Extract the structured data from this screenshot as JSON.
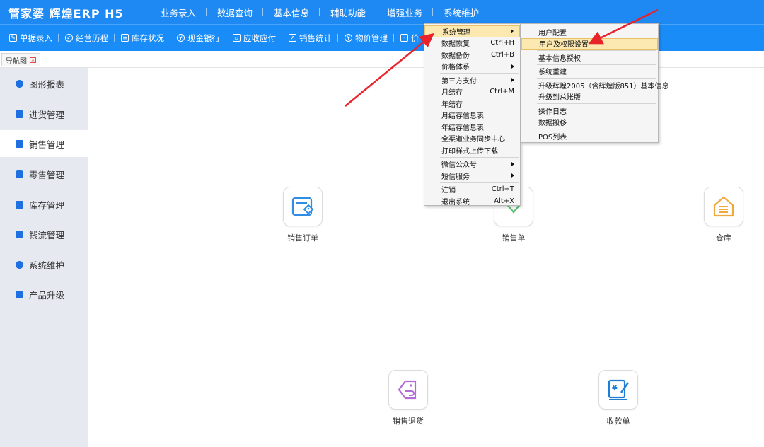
{
  "header": {
    "logo": "管家婆 辉煌ERP H5",
    "nav": [
      "业务录入",
      "数据查询",
      "基本信息",
      "辅助功能",
      "增强业务",
      "系统维护"
    ]
  },
  "toolbar": {
    "items": [
      {
        "label": "单据录入",
        "icon": "edit-icon"
      },
      {
        "label": "经营历程",
        "icon": "history-icon"
      },
      {
        "label": "库存状况",
        "icon": "calendar-icon"
      },
      {
        "label": "现金银行",
        "icon": "money-icon"
      },
      {
        "label": "应收应付",
        "icon": "receivable-icon"
      },
      {
        "label": "销售统计",
        "icon": "chart-icon"
      },
      {
        "label": "物价管理",
        "icon": "price-icon"
      },
      {
        "label": "价",
        "icon": "tag-icon"
      }
    ]
  },
  "tabs": {
    "nav_tab": "导航图"
  },
  "sidebar": {
    "items": [
      {
        "label": "图形报表",
        "icon": "chart-icon"
      },
      {
        "label": "进货管理",
        "icon": "purchase-icon"
      },
      {
        "label": "销售管理",
        "icon": "sales-icon"
      },
      {
        "label": "零售管理",
        "icon": "retail-icon"
      },
      {
        "label": "库存管理",
        "icon": "inventory-icon"
      },
      {
        "label": "钱流管理",
        "icon": "cashflow-icon"
      },
      {
        "label": "系统维护",
        "icon": "settings-icon"
      },
      {
        "label": "产品升级",
        "icon": "upgrade-icon"
      }
    ],
    "active_index": 2
  },
  "main": {
    "tiles": [
      {
        "label": "销售订单",
        "icon": "sales-order-icon",
        "color": "#2f8de4"
      },
      {
        "label": "销售单",
        "icon": "sales-slip-icon",
        "color": "#5bbf7a"
      },
      {
        "label": "仓库",
        "icon": "warehouse-icon",
        "color": "#f0a73c"
      },
      {
        "label": "销售退货",
        "icon": "sales-return-icon",
        "color": "#b46bd8"
      },
      {
        "label": "收款单",
        "icon": "receipt-icon",
        "color": "#1f7fd8"
      }
    ]
  },
  "menu_system": {
    "items": [
      {
        "label": "系统管理",
        "shortcut": "",
        "submenu": true
      },
      {
        "label": "数据恢复",
        "shortcut": "Ctrl+H",
        "submenu": false
      },
      {
        "label": "数据备份",
        "shortcut": "Ctrl+B",
        "submenu": false
      },
      {
        "label": "价格体系",
        "shortcut": "",
        "submenu": true
      },
      {
        "label": "第三方支付",
        "shortcut": "",
        "submenu": true
      },
      {
        "label": "月结存",
        "shortcut": "Ctrl+M",
        "submenu": false
      },
      {
        "label": "年结存",
        "shortcut": "",
        "submenu": false
      },
      {
        "label": "月结存信息表",
        "shortcut": "",
        "submenu": false
      },
      {
        "label": "年结存信息表",
        "shortcut": "",
        "submenu": false
      },
      {
        "label": "全渠道业务同步中心",
        "shortcut": "",
        "submenu": false
      },
      {
        "label": "打印样式上传下载",
        "shortcut": "",
        "submenu": false
      },
      {
        "label": "微信公众号",
        "shortcut": "",
        "submenu": true
      },
      {
        "label": "短信服务",
        "shortcut": "",
        "submenu": true
      },
      {
        "label": "注销",
        "shortcut": "Ctrl+T",
        "submenu": false
      },
      {
        "label": "退出系统",
        "shortcut": "Alt+X",
        "submenu": false
      }
    ]
  },
  "menu_admin": {
    "items": [
      "用户配置",
      "用户及权限设置",
      "基本信息授权",
      "系统重建",
      "升级辉煌2005（含辉煌版851）基本信息",
      "升级到总账版",
      "操作日志",
      "数据搬移",
      "POS列表"
    ]
  },
  "colors": {
    "header_bg": "#1e88f3",
    "toolbar_bg": "#1a8cf8",
    "sidebar_bg": "#e6e9ef",
    "menu_highlight": "#fbe9b1",
    "annotation_arrow": "#e8232a"
  }
}
